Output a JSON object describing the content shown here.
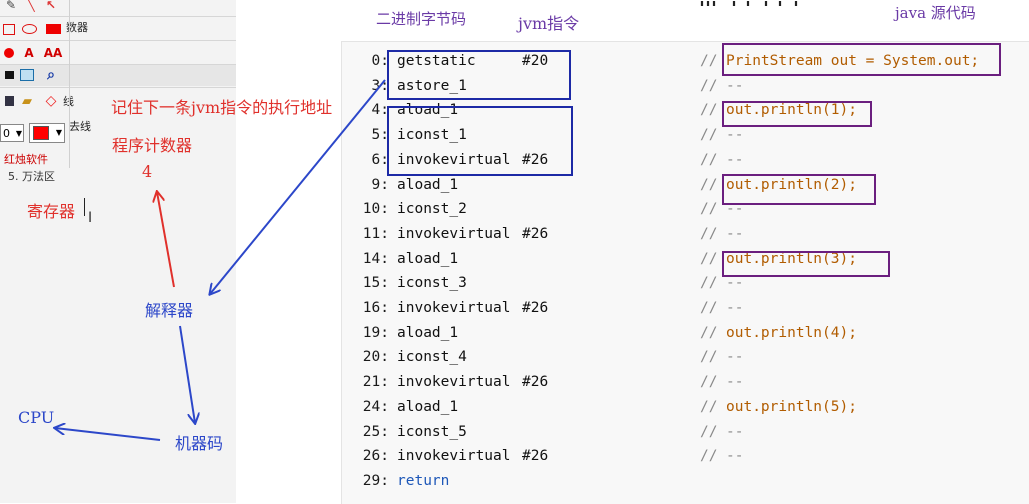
{
  "headers": {
    "bytecode": "二进制字节码",
    "jvm": "jvm指令",
    "java_source": "java 源代码"
  },
  "toolbar": {
    "top_label": "数器",
    "line_label": "线",
    "eraser_label": "去线",
    "size_value": "0",
    "brand": "红烛软件",
    "method_area": "5. 万法区",
    "color_fill": "#ff0000",
    "tools": [
      "A",
      "AA"
    ]
  },
  "annotations": {
    "note": "记住下一条jvm指令的执行地址",
    "pc": "程序计数器",
    "pc_value": "4",
    "register": "寄存器",
    "interpreter": "解释器",
    "machine_code": "机器码",
    "cpu": "CPU"
  },
  "code": {
    "lines": [
      {
        "no": "0:",
        "ins": "getstatic",
        "arg": "#20",
        "cm": "//",
        "src": "PrintStream out = System.out;"
      },
      {
        "no": "3:",
        "ins": "astore_1",
        "arg": "",
        "cm": "//",
        "src": "--"
      },
      {
        "no": "4:",
        "ins": "aload_1",
        "arg": "",
        "cm": "//",
        "src": "out.println(1);"
      },
      {
        "no": "5:",
        "ins": "iconst_1",
        "arg": "",
        "cm": "//",
        "src": "--"
      },
      {
        "no": "6:",
        "ins": "invokevirtual",
        "arg": "#26",
        "cm": "//",
        "src": "--"
      },
      {
        "no": "9:",
        "ins": "aload_1",
        "arg": "",
        "cm": "//",
        "src": "out.println(2);"
      },
      {
        "no": "10:",
        "ins": "iconst_2",
        "arg": "",
        "cm": "//",
        "src": "--"
      },
      {
        "no": "11:",
        "ins": "invokevirtual",
        "arg": "#26",
        "cm": "//",
        "src": "--"
      },
      {
        "no": "14:",
        "ins": "aload_1",
        "arg": "",
        "cm": "//",
        "src": "out.println(3);"
      },
      {
        "no": "15:",
        "ins": "iconst_3",
        "arg": "",
        "cm": "//",
        "src": "--"
      },
      {
        "no": "16:",
        "ins": "invokevirtual",
        "arg": "#26",
        "cm": "//",
        "src": "--"
      },
      {
        "no": "19:",
        "ins": "aload_1",
        "arg": "",
        "cm": "//",
        "src": "out.println(4);"
      },
      {
        "no": "20:",
        "ins": "iconst_4",
        "arg": "",
        "cm": "//",
        "src": "--"
      },
      {
        "no": "21:",
        "ins": "invokevirtual",
        "arg": "#26",
        "cm": "//",
        "src": "--"
      },
      {
        "no": "24:",
        "ins": "aload_1",
        "arg": "",
        "cm": "//",
        "src": "out.println(5);"
      },
      {
        "no": "25:",
        "ins": "iconst_5",
        "arg": "",
        "cm": "//",
        "src": "--"
      },
      {
        "no": "26:",
        "ins": "invokevirtual",
        "arg": "#26",
        "cm": "//",
        "src": "--"
      },
      {
        "no": "29:",
        "ins": "return",
        "arg": "",
        "cm": "",
        "src": ""
      }
    ]
  },
  "colors": {
    "red_annotation": "#e0302b",
    "blue_annotation": "#2c47c9",
    "navy_box": "#1d2aa6",
    "purple_box": "#6b1f7f",
    "header_purple": "#6a3aa6"
  }
}
